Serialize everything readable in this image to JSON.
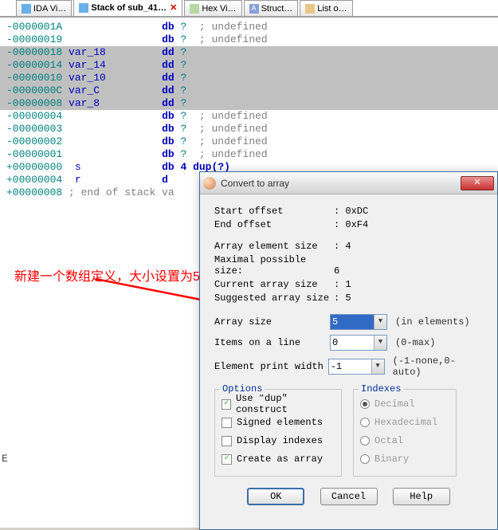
{
  "tabs": [
    {
      "label": "IDA Vi…"
    },
    {
      "label": "Stack of sub_41…",
      "active": true,
      "closable": true
    },
    {
      "label": "Hex Vi…"
    },
    {
      "label": "Struct…"
    },
    {
      "label": "List o…"
    }
  ],
  "code_lines": [
    {
      "addr": "-0000001A",
      "inst": "db",
      "op": "?",
      "cmt": "; undefined"
    },
    {
      "addr": "-00000019",
      "inst": "db",
      "op": "?",
      "cmt": "; undefined"
    },
    {
      "addr": "-00000018",
      "var": "var_18",
      "inst": "dd",
      "op": "?",
      "hl": true
    },
    {
      "addr": "-00000014",
      "var": "var_14",
      "inst": "dd",
      "op": "?",
      "hl": true
    },
    {
      "addr": "-00000010",
      "var": "var_10",
      "inst": "dd",
      "op": "?",
      "hl": true
    },
    {
      "addr": "-0000000C",
      "var": "var_C",
      "inst": "dd",
      "op": "?",
      "hl": true
    },
    {
      "addr": "-00000008",
      "var": "var_8",
      "inst": "dd",
      "op": "?",
      "hl": true
    },
    {
      "addr": "-00000004",
      "inst": "db",
      "op": "?",
      "cmt": "; undefined"
    },
    {
      "addr": "-00000003",
      "inst": "db",
      "op": "?",
      "cmt": "; undefined"
    },
    {
      "addr": "-00000002",
      "inst": "db",
      "op": "?",
      "cmt": "; undefined"
    },
    {
      "addr": "-00000001",
      "inst": "db",
      "op": "?",
      "cmt": "; undefined"
    },
    {
      "addr": "+00000000",
      "var": " s",
      "inst": "db 4 dup(?)",
      "op": ""
    },
    {
      "addr": "+00000004",
      "var": " r",
      "inst": "d",
      "op": ""
    },
    {
      "addr": "+00000008",
      "cmt_only": "; end of stack va"
    }
  ],
  "annotation": "新建一个数组定义，大小设置为5",
  "dialog": {
    "title": "Convert to array",
    "start_offset_lbl": "Start offset",
    "start_offset_val": ": 0xDC",
    "end_offset_lbl": "End offset",
    "end_offset_val": ": 0xF4",
    "elem_size_lbl": "Array element size",
    "elem_size_val": ": 4",
    "max_size_lbl": "Maximal possible size:",
    "max_size_val": "6",
    "cur_size_lbl": "Current array size",
    "cur_size_val": ": 1",
    "sug_size_lbl": "Suggested array size",
    "sug_size_val": ": 5",
    "array_size_lbl": "Array size",
    "array_size_val": "5",
    "array_size_sfx": "(in elements)",
    "items_line_lbl": "Items on a line",
    "items_line_val": "0",
    "items_line_sfx": "(0-max)",
    "print_width_lbl": "Element print width",
    "print_width_val": "-1",
    "print_width_sfx": "(-1-none,0-auto)",
    "options_title": "Options",
    "opt_dup": "Use \"dup\" construct",
    "opt_signed": "Signed elements",
    "opt_display": "Display indexes",
    "opt_create": "Create as array",
    "indexes_title": "Indexes",
    "idx_dec": "Decimal",
    "idx_hex": "Hexadecimal",
    "idx_oct": "Octal",
    "idx_bin": "Binary",
    "btn_ok": "OK",
    "btn_cancel": "Cancel",
    "btn_help": "Help"
  },
  "side_letter": "E"
}
